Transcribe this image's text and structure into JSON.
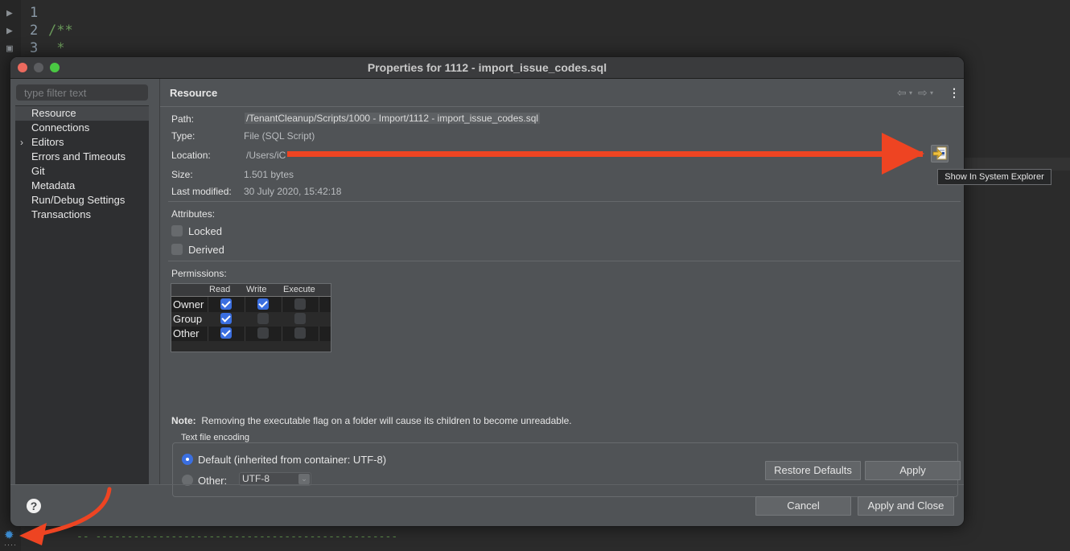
{
  "editor": {
    "lines": [
      {
        "num": "1",
        "code": "",
        "marker": "▶"
      },
      {
        "num": "2",
        "code": "/**",
        "marker": "▶"
      },
      {
        "num": "3",
        "code": " *",
        "marker": "▣"
      }
    ],
    "bottom_code": "-- ------------------------------------------------"
  },
  "dialog": {
    "title": "Properties for 1112 - import_issue_codes.sql",
    "filter_placeholder": "type filter text",
    "tree": [
      {
        "label": "Resource",
        "selected": true,
        "expandable": false
      },
      {
        "label": "Connections",
        "selected": false,
        "expandable": false
      },
      {
        "label": "Editors",
        "selected": false,
        "expandable": true
      },
      {
        "label": "Errors and Timeouts",
        "selected": false,
        "expandable": false
      },
      {
        "label": "Git",
        "selected": false,
        "expandable": false
      },
      {
        "label": "Metadata",
        "selected": false,
        "expandable": false
      },
      {
        "label": "Run/Debug Settings",
        "selected": false,
        "expandable": false
      },
      {
        "label": "Transactions",
        "selected": false,
        "expandable": false
      }
    ],
    "page_title": "Resource",
    "nav": {
      "back": "⇦",
      "forward": "⇨",
      "menu": "⋮",
      "dropdown": "▾"
    },
    "info": {
      "path_label": "Path:",
      "path_value": "/TenantCleanup/Scripts/1000 - Import/1112 - import_issue_codes.sql",
      "type_label": "Type:",
      "type_value": "File  (SQL Script)",
      "location_label": "Location:",
      "location_value": "/Users/iC",
      "size_label": "Size:",
      "size_value": "1.501  bytes",
      "modified_label": "Last modified:",
      "modified_value": "30 July 2020, 15:42:18"
    },
    "attributes": {
      "label": "Attributes:",
      "locked": {
        "label": "Locked",
        "checked": false
      },
      "derived": {
        "label": "Derived",
        "checked": false
      }
    },
    "permissions": {
      "label": "Permissions:",
      "columns": [
        "Read",
        "Write",
        "Execute"
      ],
      "rows": [
        {
          "name": "Owner",
          "read": true,
          "write": true,
          "execute": false
        },
        {
          "name": "Group",
          "read": true,
          "write": false,
          "execute": false
        },
        {
          "name": "Other",
          "read": true,
          "write": false,
          "execute": false
        }
      ]
    },
    "note_label": "Note:",
    "note_text": "Removing the executable flag on a folder will cause its children to become unreadable.",
    "encoding": {
      "title": "Text file encoding",
      "default_label": "Default (inherited from container: UTF-8)",
      "default_selected": true,
      "other_label": "Other:",
      "other_value": "UTF-8"
    },
    "buttons": {
      "restore_defaults": "Restore Defaults",
      "apply": "Apply",
      "cancel": "Cancel",
      "apply_close": "Apply and Close",
      "help": "?"
    },
    "tooltip": "Show In System Explorer"
  },
  "annotation_color": "#ee4422"
}
